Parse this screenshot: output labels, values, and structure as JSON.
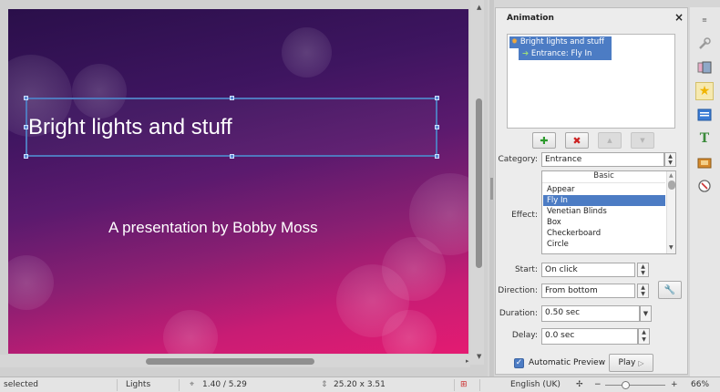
{
  "slide": {
    "title": "Bright lights and stuff",
    "subtitle": "A presentation by Bobby Moss"
  },
  "animation_panel": {
    "title": "Animation",
    "close_label": "×",
    "list": [
      {
        "label": "Bright lights and stuff"
      },
      {
        "label": "Entrance: Fly In"
      }
    ],
    "category_label": "Category:",
    "category_value": "Entrance",
    "effect_label": "Effect:",
    "effect_group": "Basic",
    "effects": [
      "Appear",
      "Fly In",
      "Venetian Blinds",
      "Box",
      "Checkerboard",
      "Circle"
    ],
    "selected_effect": "Fly In",
    "start_label": "Start:",
    "start_value": "On click",
    "direction_label": "Direction:",
    "direction_value": "From bottom",
    "duration_label": "Duration:",
    "duration_value": "0.50 sec",
    "delay_label": "Delay:",
    "delay_value": "0.0 sec",
    "auto_preview_label": "Automatic Preview",
    "auto_preview_checked": true,
    "play_label": "Play"
  },
  "sidebar_icons": [
    "properties-icon",
    "wrench-icon",
    "slide-transition-icon",
    "animation-star-icon",
    "master-slides-icon",
    "styles-icon",
    "gallery-icon",
    "navigator-icon"
  ],
  "statusbar": {
    "selection": "selected",
    "layout": "Lights",
    "position": "1.40 / 5.29",
    "size": "25.20 x 3.51",
    "language": "English (UK)",
    "zoom": "66%",
    "zoom_minus": "−",
    "zoom_plus": "+"
  },
  "colors": {
    "selection_blue": "#4c7cc4",
    "slide_gradient_top": "#2a0f4a",
    "slide_gradient_bottom": "#e41b72"
  }
}
